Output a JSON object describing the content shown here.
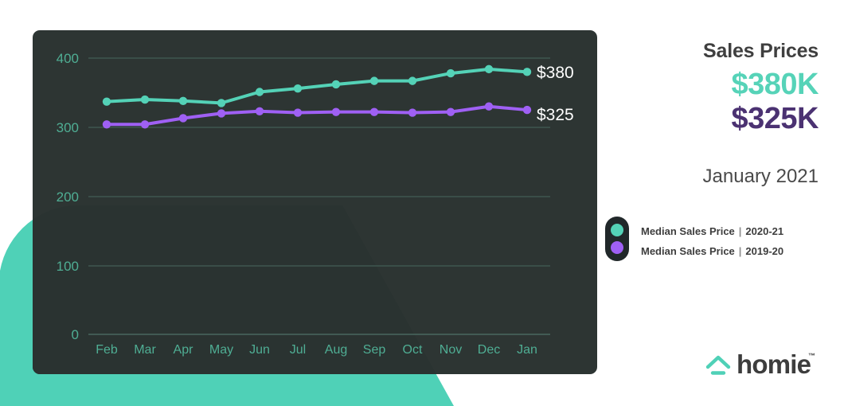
{
  "panel": {
    "title": "Sales Prices",
    "value_primary": "$380K",
    "value_secondary": "$325K",
    "date": "January 2021",
    "color_primary": "#54d2b7",
    "color_secondary": "#4b3272"
  },
  "legend": {
    "rows": [
      {
        "label": "Median Sales Price",
        "separator": "|",
        "period": "2020-21",
        "color": "#54d2b7"
      },
      {
        "label": "Median Sales Price",
        "separator": "|",
        "period": "2019-20",
        "color": "#9f60f4"
      }
    ]
  },
  "logo": {
    "word": "homie",
    "tm": "™",
    "mark": "house-roof-icon"
  },
  "endpoint_labels": {
    "primary": "$380",
    "secondary": "$325"
  },
  "chart_data": {
    "type": "line",
    "title": "Sales Prices",
    "xlabel": "",
    "ylabel": "",
    "ylim": [
      0,
      430
    ],
    "yticks": [
      0,
      100,
      200,
      300,
      400
    ],
    "ytick_labels": [
      "0",
      "100",
      "200",
      "300",
      "400"
    ],
    "grid": true,
    "grid_color": "#3c524c",
    "axis_text_color": "#4fae94",
    "background": "#2d3533",
    "legend_position": "right",
    "categories": [
      "Feb",
      "Mar",
      "Apr",
      "May",
      "Jun",
      "Jul",
      "Aug",
      "Sep",
      "Oct",
      "Nov",
      "Dec",
      "Jan"
    ],
    "series": [
      {
        "name": "Median Sales Price | 2020-21",
        "color": "#54d2b7",
        "end_label": "$380",
        "values": [
          337,
          340,
          338,
          335,
          351,
          356,
          362,
          367,
          367,
          378,
          384,
          380
        ]
      },
      {
        "name": "Median Sales Price | 2019-20",
        "color": "#9f60f4",
        "end_label": "$325",
        "values": [
          304,
          304,
          313,
          320,
          323,
          321,
          322,
          322,
          321,
          322,
          330,
          325
        ]
      }
    ]
  }
}
